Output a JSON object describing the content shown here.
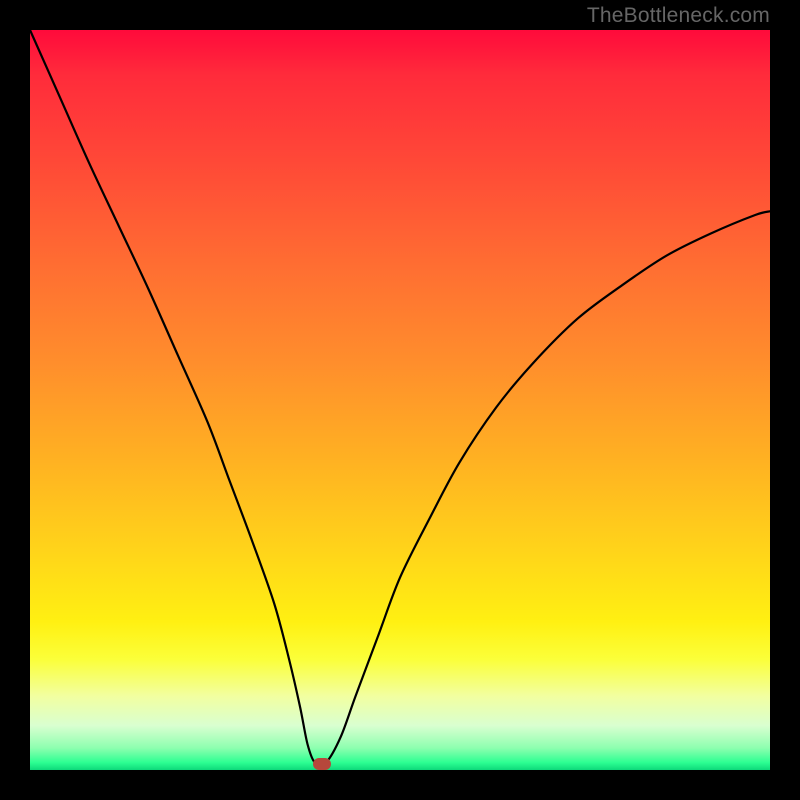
{
  "watermark": "TheBottleneck.com",
  "colors": {
    "frame": "#000000",
    "curve": "#000000",
    "marker": "#b6473b",
    "gradient_top": "#ff0a3b",
    "gradient_bottom": "#0dd97a"
  },
  "chart_data": {
    "type": "line",
    "title": "",
    "xlabel": "",
    "ylabel": "",
    "xlim": [
      0,
      100
    ],
    "ylim": [
      0,
      100
    ],
    "grid": false,
    "series": [
      {
        "name": "bottleneck-curve",
        "x": [
          0,
          4,
          8,
          12,
          16,
          20,
          24,
          27,
          30,
          33,
          35,
          36.5,
          37.5,
          38.5,
          40,
          42,
          44,
          47,
          50,
          54,
          58,
          63,
          68,
          74,
          80,
          86,
          92,
          98,
          100
        ],
        "y": [
          100,
          91,
          82,
          73.5,
          65,
          56,
          47,
          39,
          31,
          22.5,
          15,
          8.5,
          3.5,
          1.0,
          1.0,
          4.5,
          10,
          18,
          26,
          34,
          41.5,
          49,
          55,
          61,
          65.5,
          69.5,
          72.5,
          75,
          75.5
        ]
      }
    ],
    "annotations": [
      {
        "name": "optimal-marker",
        "x": 39.5,
        "y": 0.8
      }
    ]
  }
}
